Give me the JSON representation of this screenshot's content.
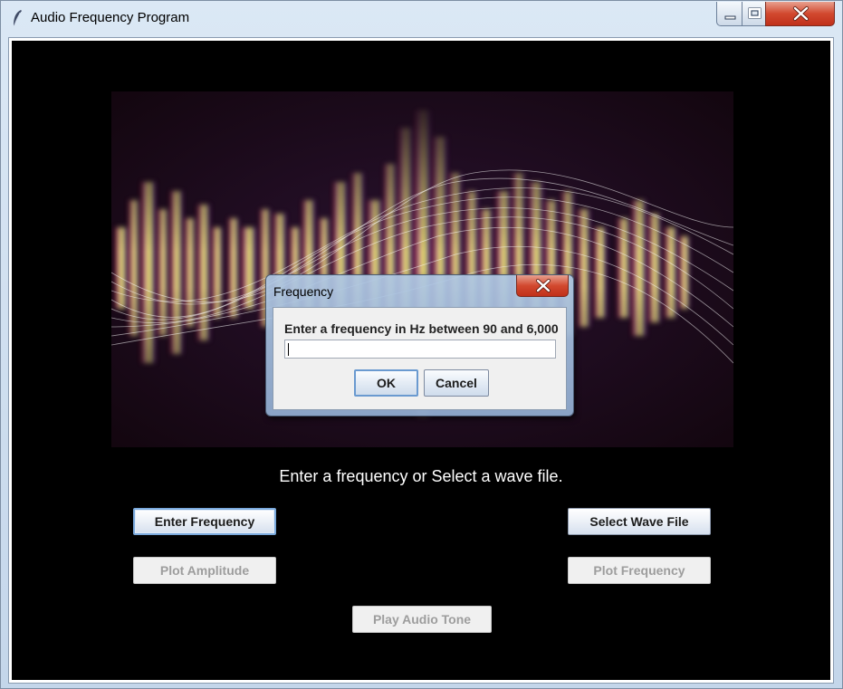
{
  "window": {
    "title": "Audio Frequency Program"
  },
  "main": {
    "prompt": "Enter a frequency or Select a wave file.",
    "buttons": {
      "enter_frequency": "Enter Frequency",
      "select_wave_file": "Select Wave File",
      "plot_amplitude": "Plot Amplitude",
      "plot_frequency": "Plot Frequency",
      "play_audio_tone": "Play Audio Tone"
    }
  },
  "dialog": {
    "title": "Frequency",
    "message": "Enter a frequency in Hz between 90 and 6,000",
    "input_value": "",
    "ok_label": "OK",
    "cancel_label": "Cancel"
  }
}
